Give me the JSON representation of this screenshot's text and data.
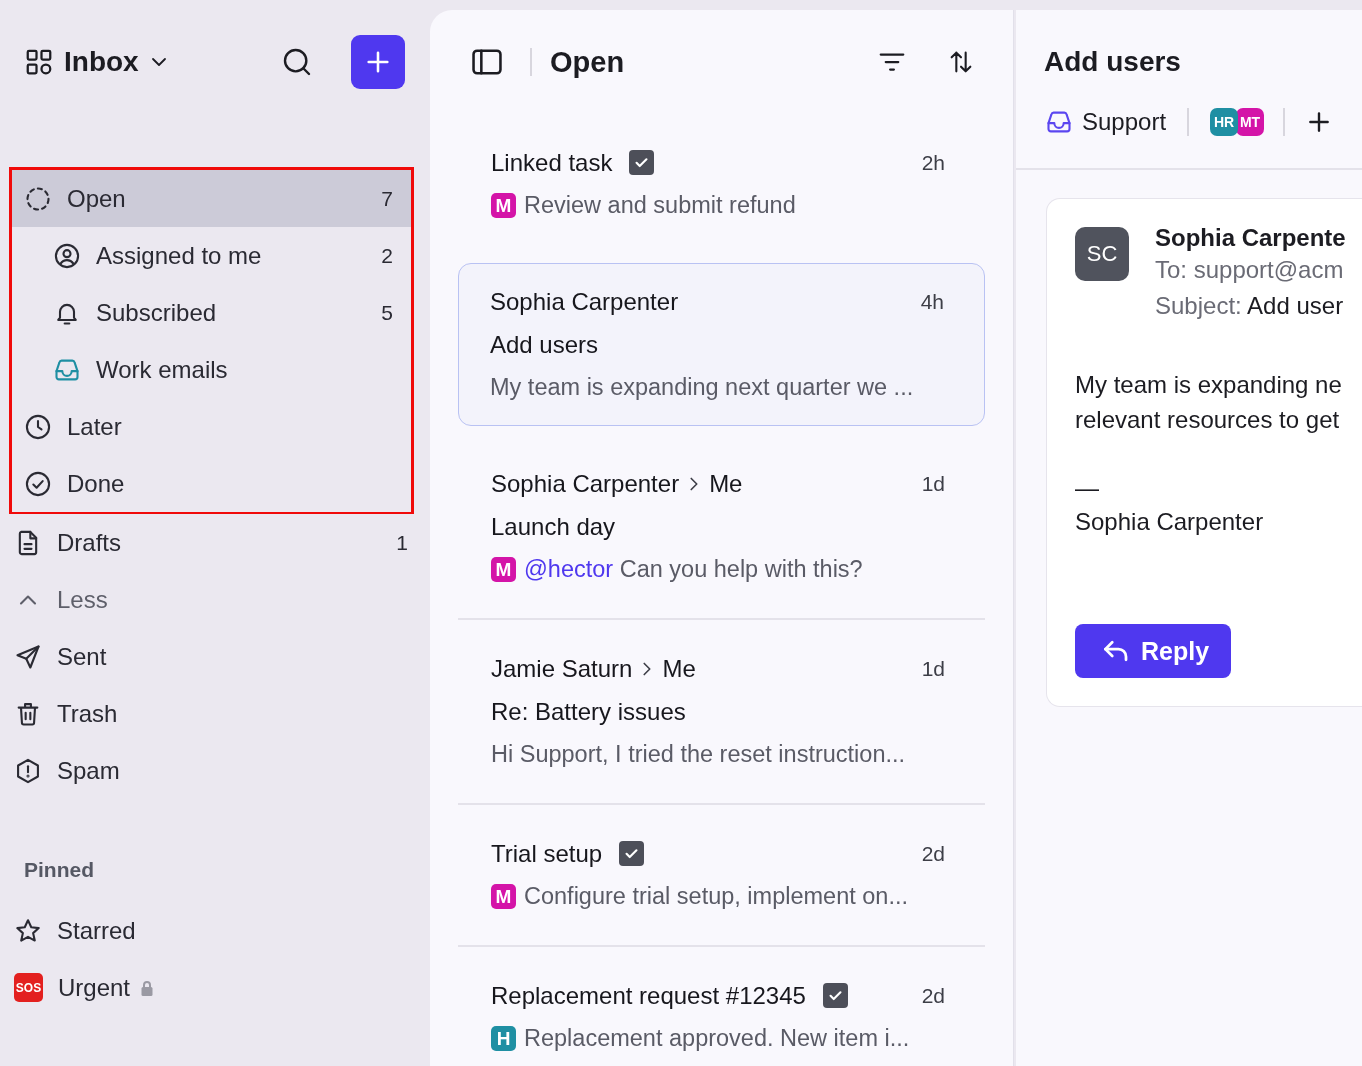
{
  "sidebar": {
    "title": "Inbox",
    "marked_group": {
      "items": [
        {
          "kind": "folder",
          "label": "Open",
          "count": "7",
          "selected": true,
          "children": [
            {
              "kind": "folder",
              "label": "Assigned to me",
              "count": "2",
              "selected": false
            },
            {
              "kind": "folder",
              "label": "Subscribed",
              "count": "5",
              "selected": false
            },
            {
              "kind": "folder",
              "label": "Work emails",
              "selected": false
            }
          ]
        },
        {
          "kind": "folder",
          "label": "Later",
          "selected": false
        },
        {
          "kind": "folder",
          "label": "Done",
          "selected": false
        }
      ]
    },
    "items": [
      {
        "kind": "folder",
        "label": "Drafts",
        "count": "1",
        "selected": false
      },
      {
        "kind": "toggle",
        "label": "Less",
        "selected": false
      },
      {
        "kind": "folder",
        "label": "Sent",
        "selected": false
      },
      {
        "kind": "folder",
        "label": "Trash",
        "selected": false
      },
      {
        "kind": "folder",
        "label": "Spam",
        "selected": false
      }
    ],
    "pinned": {
      "title": "Pinned",
      "items": [
        {
          "label": "Starred",
          "locked": false
        },
        {
          "label": "Urgent",
          "emblem": "SOS",
          "locked": true
        }
      ]
    }
  },
  "list": {
    "title": "Open",
    "items": [
      {
        "kind": "task",
        "title": "Linked task",
        "checked": true,
        "time": "2h",
        "badge": {
          "letter": "M",
          "color": "#d414a8"
        },
        "preview": "Review and submit refund",
        "selected": false
      },
      {
        "kind": "email",
        "from": "Sophia Carpenter",
        "time": "4h",
        "subject": "Add users",
        "preview": "My team is expanding next quarter we ...",
        "selected": true
      },
      {
        "kind": "email",
        "from": "Sophia Carpenter",
        "to": "Me",
        "time": "1d",
        "subject": "Launch day",
        "badge": {
          "letter": "M",
          "color": "#d414a8"
        },
        "mention": "@hector",
        "preview": "Can you help with this?",
        "selected": false
      },
      {
        "kind": "email",
        "from": "Jamie Saturn",
        "to": "Me",
        "time": "1d",
        "subject": "Re: Battery issues",
        "preview": "Hi Support, I tried the reset instruction...",
        "selected": false
      },
      {
        "kind": "task",
        "title": "Trial setup",
        "checked": true,
        "time": "2d",
        "badge": {
          "letter": "M",
          "color": "#d414a8"
        },
        "preview": "Configure trial setup, implement on...",
        "selected": false
      },
      {
        "kind": "task",
        "title": "Replacement request #12345",
        "checked": true,
        "time": "2d",
        "badge": {
          "letter": "H",
          "color": "#1f8fa3"
        },
        "preview": "Replacement approved. New item i...",
        "selected": false
      }
    ]
  },
  "detail": {
    "title": "Add users",
    "inbox": "Support",
    "assignees": [
      {
        "initials": "HR",
        "color": "#1f8fa3"
      },
      {
        "initials": "MT",
        "color": "#d414a8"
      }
    ],
    "message": {
      "initials": "SC",
      "sender": "Sophia Carpente",
      "to": "To: support@acm",
      "subject_label": "Subject:",
      "subject": "Add user",
      "body_lines": [
        "My team is expanding ne",
        "relevant resources to get"
      ],
      "signature_dash": "—",
      "signature": "Sophia Carpenter"
    },
    "reply_button": "Reply"
  }
}
